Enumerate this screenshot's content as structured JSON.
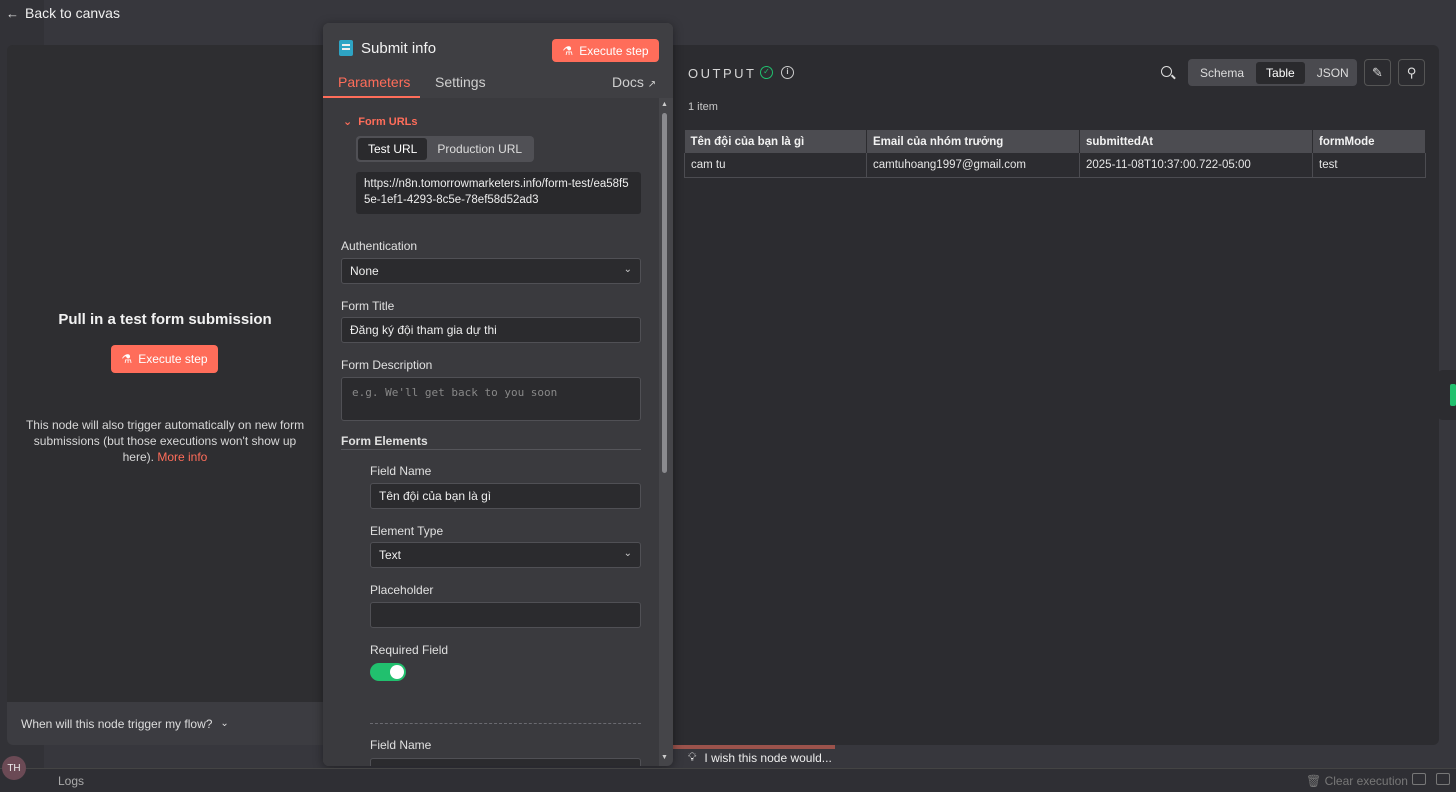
{
  "nav": {
    "back_label": "Back to canvas"
  },
  "left_panel": {
    "title": "Pull in a test form submission",
    "execute_label": "Execute step",
    "description": "This node will also trigger automatically on new form submissions (but those executions won't show up here).",
    "more_info": "More info",
    "footer": "When will this node trigger my flow?"
  },
  "node": {
    "title": "Submit info",
    "execute_label": "Execute step",
    "tabs": [
      "Parameters",
      "Settings"
    ],
    "docs_label": "Docs"
  },
  "params": {
    "form_urls_label": "Form URLs",
    "url_tabs": [
      "Test URL",
      "Production URL"
    ],
    "test_url": "https://n8n.tomorrowmarketers.info/form-test/ea58f55e-1ef1-4293-8c5e-78ef58d52ad3",
    "authentication_label": "Authentication",
    "authentication_value": "None",
    "form_title_label": "Form Title",
    "form_title_value": "Đăng ký đội tham gia dự thi",
    "form_description_label": "Form Description",
    "form_description_placeholder": "e.g. We'll get back to you soon",
    "form_elements_label": "Form Elements",
    "element1": {
      "field_name_label": "Field Name",
      "field_name_value": "Tên đội của bạn là gì",
      "element_type_label": "Element Type",
      "element_type_value": "Text",
      "placeholder_label": "Placeholder",
      "placeholder_value": "",
      "required_label": "Required Field",
      "required_on": true
    },
    "element2": {
      "field_name_label": "Field Name"
    }
  },
  "output": {
    "title": "OUTPUT",
    "views": [
      "Schema",
      "Table",
      "JSON"
    ],
    "active_view": "Table",
    "item_count": "1 item",
    "columns": [
      "Tên đội của bạn là gì",
      "Email của nhóm trưởng",
      "submittedAt",
      "formMode"
    ],
    "rows": [
      [
        "cam tu",
        "camtuhoang1997@gmail.com",
        "2025-11-08T10:37:00.722-05:00",
        "test"
      ]
    ]
  },
  "feedback": {
    "wish_label": "I wish this node would..."
  },
  "bottom": {
    "avatar": "TH",
    "logs_label": "Logs",
    "clear_execution": "Clear execution"
  },
  "colors": {
    "accent": "#ff6d5a",
    "success": "#21c06e",
    "panel": "#2c2c30"
  }
}
